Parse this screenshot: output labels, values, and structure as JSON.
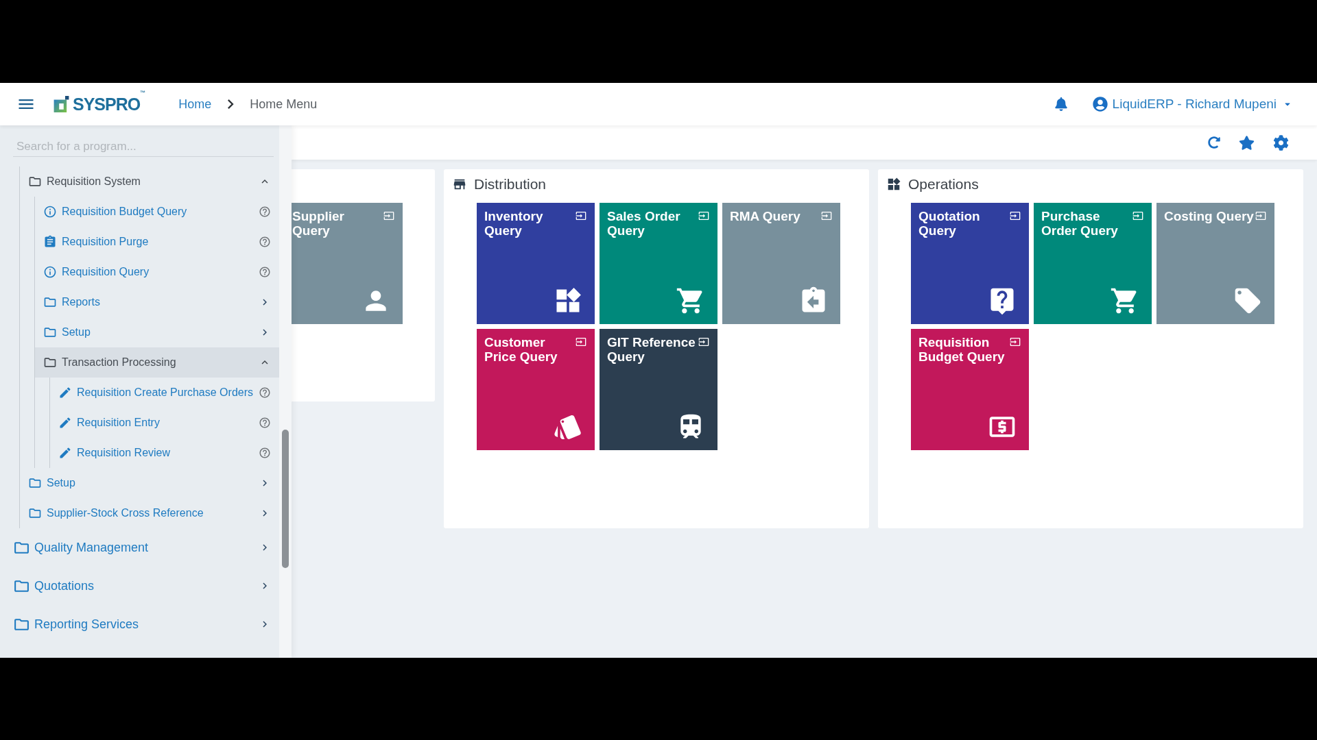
{
  "header": {
    "logo": "SYSPRO$^{™}$",
    "breadcrumbs": [
      "Home",
      "Home Menu"
    ],
    "user": "LiquidERP - Richard Mupeni"
  },
  "sidebar": {
    "search": {
      "placeholder": "Search for a program..."
    },
    "tree": [
      {
        "kind": "group",
        "children": [
          {
            "kind": "folder",
            "label": "Requisition System",
            "expanded": true,
            "hovered": false,
            "children": [
              {
                "kind": "query",
                "label": "Requisition Budget Query",
                "hovered": false
              },
              {
                "kind": "utility",
                "label": "Requisition Purge",
                "hovered": false
              },
              {
                "kind": "query",
                "label": "Requisition Query",
                "hovered": false
              },
              {
                "kind": "folder",
                "label": "Reports",
                "expanded": false,
                "hovered": false
              },
              {
                "kind": "folder",
                "label": "Setup",
                "expanded": false,
                "hovered": false
              },
              {
                "kind": "folder",
                "label": "Transaction Processing",
                "expanded": true,
                "hovered": true,
                "children": [
                  {
                    "kind": "entry",
                    "label": "Requisition Create Purchase Orders",
                    "hovered": false
                  },
                  {
                    "kind": "entry",
                    "label": "Requisition Entry",
                    "hovered": false
                  },
                  {
                    "kind": "entry",
                    "label": "Requisition Review",
                    "hovered": false
                  }
                ]
              }
            ]
          },
          {
            "kind": "folder",
            "label": "Setup",
            "expanded": false,
            "hovered": false
          },
          {
            "kind": "folder",
            "label": "Supplier-Stock Cross Reference",
            "expanded": false,
            "hovered": false
          }
        ]
      },
      {
        "kind": "folder",
        "label": "Quality Management",
        "expanded": false,
        "hovered": false
      },
      {
        "kind": "folder",
        "label": "Quotations",
        "expanded": false,
        "hovered": false
      },
      {
        "kind": "folder",
        "label": "Reporting Services",
        "expanded": false,
        "hovered": false
      }
    ]
  },
  "groups": [
    {
      "tiles": [
        {
          "title": "Supplier Query",
          "color": "#78909c"
        }
      ]
    },
    {
      "title": "Distribution",
      "tiles": [
        {
          "title": "Inventory Query",
          "color": "#303f9f"
        },
        {
          "title": "Sales Order Query",
          "color": "#00897b"
        },
        {
          "title": "RMA Query",
          "color": "#78909c"
        },
        {
          "title": "Customer Price Query",
          "color": "#c2185b"
        },
        {
          "title": "GIT Reference Query",
          "color": "#2c3e50"
        }
      ]
    },
    {
      "title": "Operations",
      "tiles": [
        {
          "title": "Quotation Query",
          "color": "#303f9f"
        },
        {
          "title": "Purchase Order Query",
          "color": "#00897b"
        },
        {
          "title": "Costing Query",
          "color": "#78909c"
        },
        {
          "title": "Requisition Budget Query",
          "color": "#c2185b"
        }
      ]
    }
  ]
}
